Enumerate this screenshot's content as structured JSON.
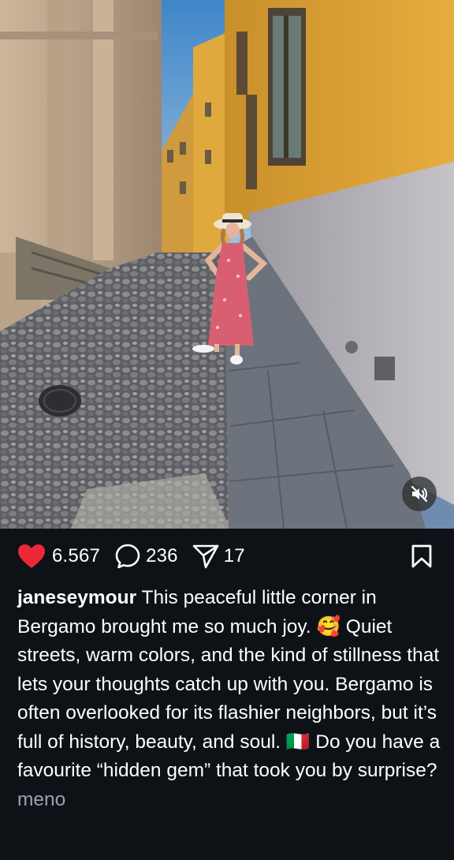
{
  "post": {
    "image_alt": "Woman in a pink floral dress and sun hat standing on a cobblestone street between yellow buildings in Bergamo",
    "mute_icon": "speaker-muted-icon"
  },
  "actions": {
    "likes_count": "6.567",
    "comments_count": "236",
    "shares_count": "17",
    "like_icon": "heart-filled-icon",
    "comment_icon": "comment-bubble-icon",
    "share_icon": "paper-plane-icon",
    "save_icon": "bookmark-icon",
    "like_color": "#ed2939"
  },
  "caption": {
    "username": "janeseymour",
    "text_part1": " This peaceful little corner in Bergamo brought me so much joy. ",
    "emoji_love": "🥰",
    "text_part2": " Quiet streets, warm colors, and the kind of stillness that lets your thoughts catch up with you. Bergamo is often overlooked for its flashier neighbors, but it’s full of history, beauty, and soul. ",
    "flag": "🇮🇹",
    "text_part3": " Do you have a favourite “hidden gem” that took you by surprise? ",
    "more_label": "meno"
  }
}
